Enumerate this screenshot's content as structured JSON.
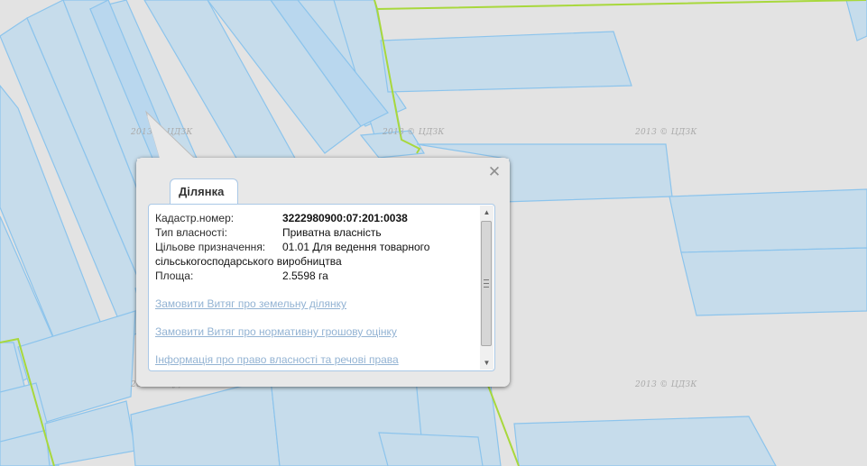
{
  "map": {
    "watermark": "2013 © ЦДЗК",
    "colors": {
      "background": "#e3e3e3",
      "parcel_fill": "#c6dceb",
      "parcel_stroke": "#8cc4ec",
      "boundary": "#a8d83c"
    }
  },
  "popup": {
    "tab_label": "Ділянка",
    "close_symbol": "✕",
    "fields": [
      {
        "label": "Кадастр.номер:",
        "value": "3222980900:07:201:0038",
        "bold": true
      },
      {
        "label": "Тип власності:",
        "value": "Приватна власність"
      },
      {
        "label": "Цільове призначення:",
        "value": "01.01 Для ведення товарного",
        "continuation": "сільськогосподарського виробництва"
      },
      {
        "label": "Площа:",
        "value": "2.5598 га"
      }
    ],
    "links": [
      "Замовити Витяг про земельну ділянку",
      "Замовити Витяг про нормативну грошову оцінку",
      "Інформація про право власності та речові права"
    ],
    "scroll_up": "▲",
    "scroll_down": "▼"
  }
}
